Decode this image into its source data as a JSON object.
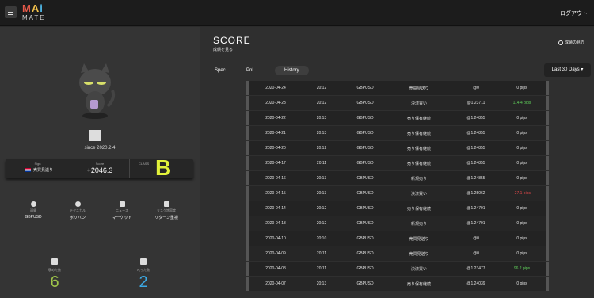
{
  "header": {
    "logo_main": "MAi",
    "logo_sub": "MATE",
    "logout": "ログアウト"
  },
  "profile": {
    "since": "since 2020.2.4",
    "sign_label": "Sign",
    "sign_value": "売買見送り",
    "score_label": "Score",
    "score_value": "+2046.3",
    "class_label": "CLASS",
    "class_value": "B",
    "tags": [
      {
        "label": "通貨",
        "value": "GBPUSD",
        "icon": "circle-icon"
      },
      {
        "label": "テクニカル",
        "value": "ボリバン",
        "icon": "gear-icon"
      },
      {
        "label": "ニュース",
        "value": "マーケット",
        "icon": "news-icon"
      },
      {
        "label": "リスク許容度",
        "value": "リターン重視",
        "icon": "chart-icon"
      }
    ],
    "praised_label": "褒めた数",
    "praised_value": "6",
    "scolded_label": "叱った数",
    "scolded_value": "2",
    "colors": {
      "class": "#e2f23a",
      "praised": "#9ec44a",
      "scolded": "#3ca9e4"
    }
  },
  "main": {
    "title": "SCORE",
    "subtitle": "成績を見る",
    "help": "成績の見方",
    "tabs": [
      "Spec",
      "PnL",
      "History"
    ],
    "active_tab": "History",
    "period": "Last 30 Days"
  },
  "history": [
    {
      "date": "2020-04-24",
      "time": "20:12",
      "pair": "GBPUSD",
      "action": "売買見送り",
      "rate": "@0",
      "pips": "0 pips",
      "pips_color": "#e0e0e0"
    },
    {
      "date": "2020-04-23",
      "time": "20:12",
      "pair": "GBPUSD",
      "action": "決済買い",
      "rate": "@1.23711",
      "pips": "114.4 pips",
      "pips_color": "#5fcf5a"
    },
    {
      "date": "2020-04-22",
      "time": "20:13",
      "pair": "GBPUSD",
      "action": "売り保有継続",
      "rate": "@1.24855",
      "pips": "0 pips",
      "pips_color": "#e0e0e0"
    },
    {
      "date": "2020-04-21",
      "time": "20:13",
      "pair": "GBPUSD",
      "action": "売り保有継続",
      "rate": "@1.24855",
      "pips": "0 pips",
      "pips_color": "#e0e0e0"
    },
    {
      "date": "2020-04-20",
      "time": "20:12",
      "pair": "GBPUSD",
      "action": "売り保有継続",
      "rate": "@1.24855",
      "pips": "0 pips",
      "pips_color": "#e0e0e0"
    },
    {
      "date": "2020-04-17",
      "time": "20:11",
      "pair": "GBPUSD",
      "action": "売り保有継続",
      "rate": "@1.24855",
      "pips": "0 pips",
      "pips_color": "#e0e0e0"
    },
    {
      "date": "2020-04-16",
      "time": "20:13",
      "pair": "GBPUSD",
      "action": "新規売り",
      "rate": "@1.24855",
      "pips": "0 pips",
      "pips_color": "#e0e0e0"
    },
    {
      "date": "2020-04-15",
      "time": "20:13",
      "pair": "GBPUSD",
      "action": "決済買い",
      "rate": "@1.25062",
      "pips": "-27.1 pips",
      "pips_color": "#e0484a"
    },
    {
      "date": "2020-04-14",
      "time": "20:12",
      "pair": "GBPUSD",
      "action": "売り保有継続",
      "rate": "@1.24791",
      "pips": "0 pips",
      "pips_color": "#e0e0e0"
    },
    {
      "date": "2020-04-13",
      "time": "20:12",
      "pair": "GBPUSD",
      "action": "新規売り",
      "rate": "@1.24791",
      "pips": "0 pips",
      "pips_color": "#e0e0e0"
    },
    {
      "date": "2020-04-10",
      "time": "20:10",
      "pair": "GBPUSD",
      "action": "売買見送り",
      "rate": "@0",
      "pips": "0 pips",
      "pips_color": "#e0e0e0"
    },
    {
      "date": "2020-04-09",
      "time": "20:11",
      "pair": "GBPUSD",
      "action": "売買見送り",
      "rate": "@0",
      "pips": "0 pips",
      "pips_color": "#e0e0e0"
    },
    {
      "date": "2020-04-08",
      "time": "20:11",
      "pair": "GBPUSD",
      "action": "決済買い",
      "rate": "@1.23477",
      "pips": "96.2 pips",
      "pips_color": "#5fcf5a"
    },
    {
      "date": "2020-04-07",
      "time": "20:13",
      "pair": "GBPUSD",
      "action": "売り保有継続",
      "rate": "@1.24039",
      "pips": "0 pips",
      "pips_color": "#e0e0e0"
    }
  ]
}
